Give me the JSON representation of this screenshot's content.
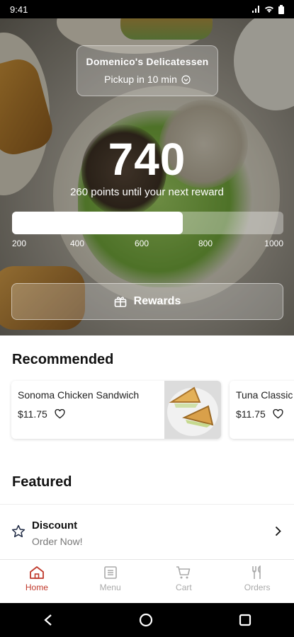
{
  "status": {
    "time": "9:41"
  },
  "hero": {
    "store_name": "Domenico's Delicatessen",
    "pickup": "Pickup in 10 min",
    "points": "740",
    "points_subtitle": "260 points until your next reward",
    "progress_fraction": 0.63,
    "progress_labels": [
      "200",
      "400",
      "600",
      "800",
      "1000"
    ],
    "rewards_label": "Rewards"
  },
  "recommended": {
    "title": "Recommended",
    "items": [
      {
        "name": "Sonoma Chicken Sandwich",
        "price": "$11.75"
      },
      {
        "name": "Tuna Classic",
        "price": "$11.75"
      }
    ]
  },
  "featured": {
    "title": "Featured",
    "items": [
      {
        "name": "Discount",
        "subtitle": "Order Now!"
      }
    ]
  },
  "tabs": [
    {
      "label": "Home",
      "icon": "home-icon",
      "active": true
    },
    {
      "label": "Menu",
      "icon": "menu-icon",
      "active": false
    },
    {
      "label": "Cart",
      "icon": "cart-icon",
      "active": false
    },
    {
      "label": "Orders",
      "icon": "utensils-icon",
      "active": false
    }
  ],
  "colors": {
    "accent": "#c0392b",
    "inactive": "#aaaaaa"
  }
}
